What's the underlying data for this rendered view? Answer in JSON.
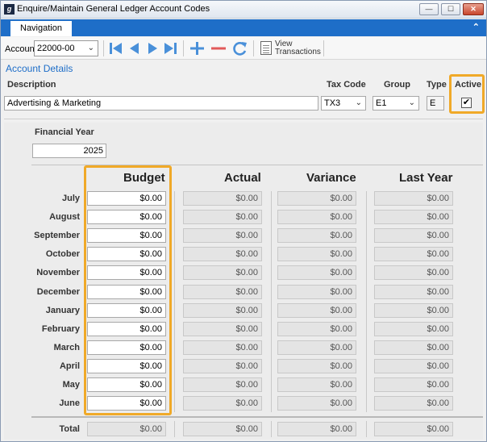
{
  "window": {
    "title": "Enquire/Maintain General Ledger Account Codes",
    "app_icon_letter": "g",
    "minimize": "—",
    "maximize": "☐",
    "close": "✕"
  },
  "nav": {
    "tab_label": "Navigation",
    "collapse_icon": "chevron-up-double-icon"
  },
  "toolbar": {
    "account_label": "Account",
    "account_value": "22000-00",
    "buttons": [
      "first-icon",
      "previous-icon",
      "next-icon",
      "last-icon",
      "add-icon",
      "delete-icon",
      "refresh-icon"
    ],
    "view_transactions_line1": "View",
    "view_transactions_line2": "Transactions"
  },
  "details": {
    "section_title": "Account Details",
    "description_label": "Description",
    "tax_code_label": "Tax Code",
    "group_label": "Group",
    "type_label": "Type",
    "active_label": "Active",
    "description_value": "Advertising & Marketing",
    "tax_code_value": "TX3",
    "group_value": "E1",
    "type_value": "E",
    "active_checked": "✔"
  },
  "financial_year": {
    "label": "Financial Year",
    "value": "2025"
  },
  "grid": {
    "columns": [
      "Budget",
      "Actual",
      "Variance",
      "Last Year"
    ],
    "rows": [
      {
        "month": "July",
        "budget": "$0.00",
        "actual": "$0.00",
        "variance": "$0.00",
        "last_year": "$0.00"
      },
      {
        "month": "August",
        "budget": "$0.00",
        "actual": "$0.00",
        "variance": "$0.00",
        "last_year": "$0.00"
      },
      {
        "month": "September",
        "budget": "$0.00",
        "actual": "$0.00",
        "variance": "$0.00",
        "last_year": "$0.00"
      },
      {
        "month": "October",
        "budget": "$0.00",
        "actual": "$0.00",
        "variance": "$0.00",
        "last_year": "$0.00"
      },
      {
        "month": "November",
        "budget": "$0.00",
        "actual": "$0.00",
        "variance": "$0.00",
        "last_year": "$0.00"
      },
      {
        "month": "December",
        "budget": "$0.00",
        "actual": "$0.00",
        "variance": "$0.00",
        "last_year": "$0.00"
      },
      {
        "month": "January",
        "budget": "$0.00",
        "actual": "$0.00",
        "variance": "$0.00",
        "last_year": "$0.00"
      },
      {
        "month": "February",
        "budget": "$0.00",
        "actual": "$0.00",
        "variance": "$0.00",
        "last_year": "$0.00"
      },
      {
        "month": "March",
        "budget": "$0.00",
        "actual": "$0.00",
        "variance": "$0.00",
        "last_year": "$0.00"
      },
      {
        "month": "April",
        "budget": "$0.00",
        "actual": "$0.00",
        "variance": "$0.00",
        "last_year": "$0.00"
      },
      {
        "month": "May",
        "budget": "$0.00",
        "actual": "$0.00",
        "variance": "$0.00",
        "last_year": "$0.00"
      },
      {
        "month": "June",
        "budget": "$0.00",
        "actual": "$0.00",
        "variance": "$0.00",
        "last_year": "$0.00"
      }
    ],
    "total": {
      "label": "Total",
      "budget": "$0.00",
      "actual": "$0.00",
      "variance": "$0.00",
      "last_year": "$0.00"
    }
  },
  "colors": {
    "accent": "#1e6ec8",
    "highlight": "#f0a928"
  }
}
